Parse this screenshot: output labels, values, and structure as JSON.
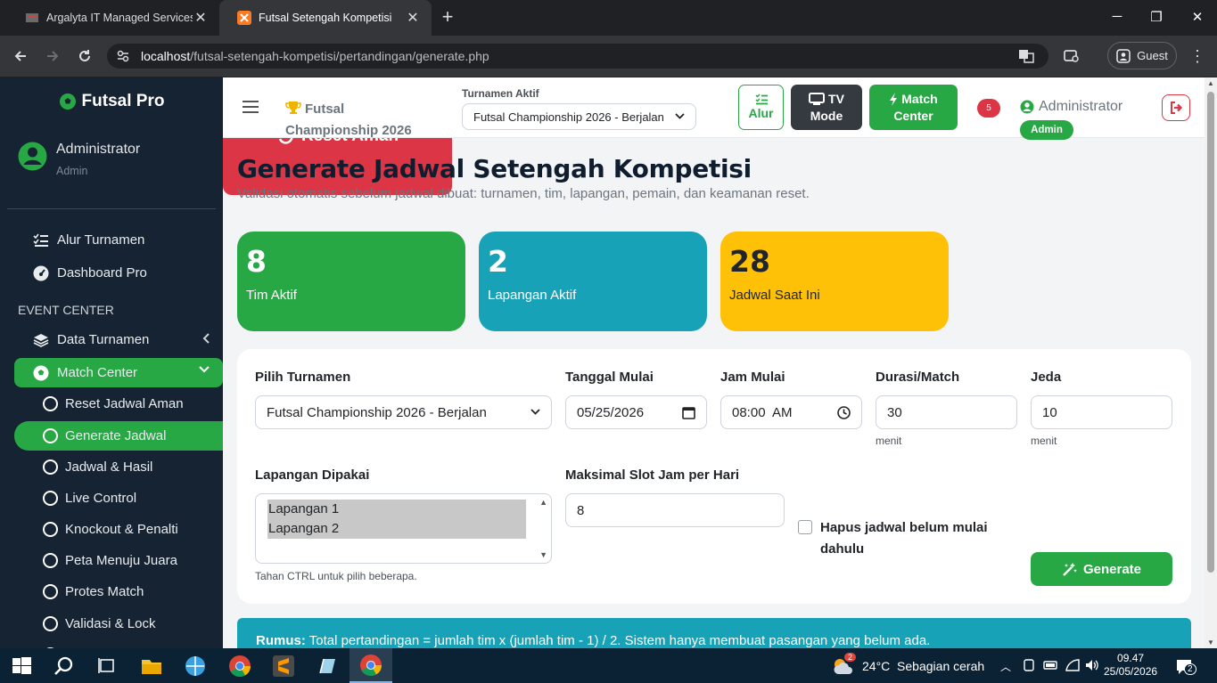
{
  "browser": {
    "tabs": [
      {
        "title": "Argalyta IT Managed Services & ",
        "active": false
      },
      {
        "title": "Futsal Setengah Kompetisi",
        "active": true
      }
    ],
    "url_host": "localhost",
    "url_path": "/futsal-setengah-kompetisi/pertandingan/generate.php",
    "profile": "Guest"
  },
  "sidebar": {
    "brand": "Futsal Pro",
    "user_name": "Administrator",
    "user_role": "Admin",
    "items_top": [
      {
        "label": "Alur Turnamen",
        "icon": "list-check-icon"
      },
      {
        "label": "Dashboard Pro",
        "icon": "gauge-icon"
      }
    ],
    "section": "EVENT CENTER",
    "data_turnamen": "Data Turnamen",
    "match_center": "Match Center",
    "sub_items": [
      {
        "label": "Reset Jadwal Aman"
      },
      {
        "label": "Generate Jadwal",
        "active": true
      },
      {
        "label": "Jadwal & Hasil"
      },
      {
        "label": "Live Control"
      },
      {
        "label": "Knockout & Penalti"
      },
      {
        "label": "Peta Menuju Juara"
      },
      {
        "label": "Protes Match"
      },
      {
        "label": "Validasi & Lock"
      }
    ]
  },
  "topbar": {
    "title": "Futsal Championship 2026",
    "active_label": "Turnamen Aktif",
    "active_value": "Futsal Championship 2026 - Berjalan",
    "btn_alur": "Alur",
    "btn_tv_1": "TV",
    "btn_tv_2": "Mode",
    "btn_mc_1": "Match",
    "btn_mc_2": "Center",
    "notif_count": "5",
    "admin_name": "Administrator",
    "admin_badge": "Admin"
  },
  "page": {
    "title": "Generate Jadwal Setengah Kompetisi",
    "subtitle": "Validasi otomatis sebelum jadwal dibuat: turnamen, tim, lapangan, pemain, dan keamanan reset."
  },
  "cards": {
    "tim_value": "8",
    "tim_label": "Tim Aktif",
    "lap_value": "2",
    "lap_label": "Lapangan Aktif",
    "jadwal_value": "28",
    "jadwal_label": "Jadwal Saat Ini",
    "reset_label": "Reset Aman"
  },
  "form": {
    "turnamen_label": "Pilih Turnamen",
    "turnamen_value": "Futsal Championship 2026 - Berjalan",
    "tanggal_label": "Tanggal Mulai",
    "tanggal_value": "05/25/2026",
    "jam_label": "Jam Mulai",
    "jam_value": "08:00  AM",
    "durasi_label": "Durasi/Match",
    "durasi_value": "30",
    "durasi_unit": "menit",
    "jeda_label": "Jeda",
    "jeda_value": "10",
    "jeda_unit": "menit",
    "lapangan_label": "Lapangan Dipakai",
    "lapangan_options": [
      "Lapangan 1",
      "Lapangan 2"
    ],
    "lapangan_help": "Tahan CTRL untuk pilih beberapa.",
    "slot_label": "Maksimal Slot Jam per Hari",
    "slot_value": "8",
    "hapus_label": "Hapus jadwal belum mulai dahulu",
    "generate_label": "Generate"
  },
  "info": {
    "bold": "Rumus:",
    "text": " Total pertandingan = jumlah tim x (jumlah tim - 1) / 2. Sistem hanya membuat pasangan yang belum ada."
  },
  "taskbar": {
    "weather_badge": "2",
    "weather": "24°C  Sebagian cerah",
    "time": "09.47",
    "date": "25/05/2026",
    "notif": "2"
  },
  "colors": {
    "green": "#28a745",
    "teal": "#17a2b8",
    "yellow": "#ffc107",
    "red": "#dc3545",
    "sidebar": "#162332"
  }
}
